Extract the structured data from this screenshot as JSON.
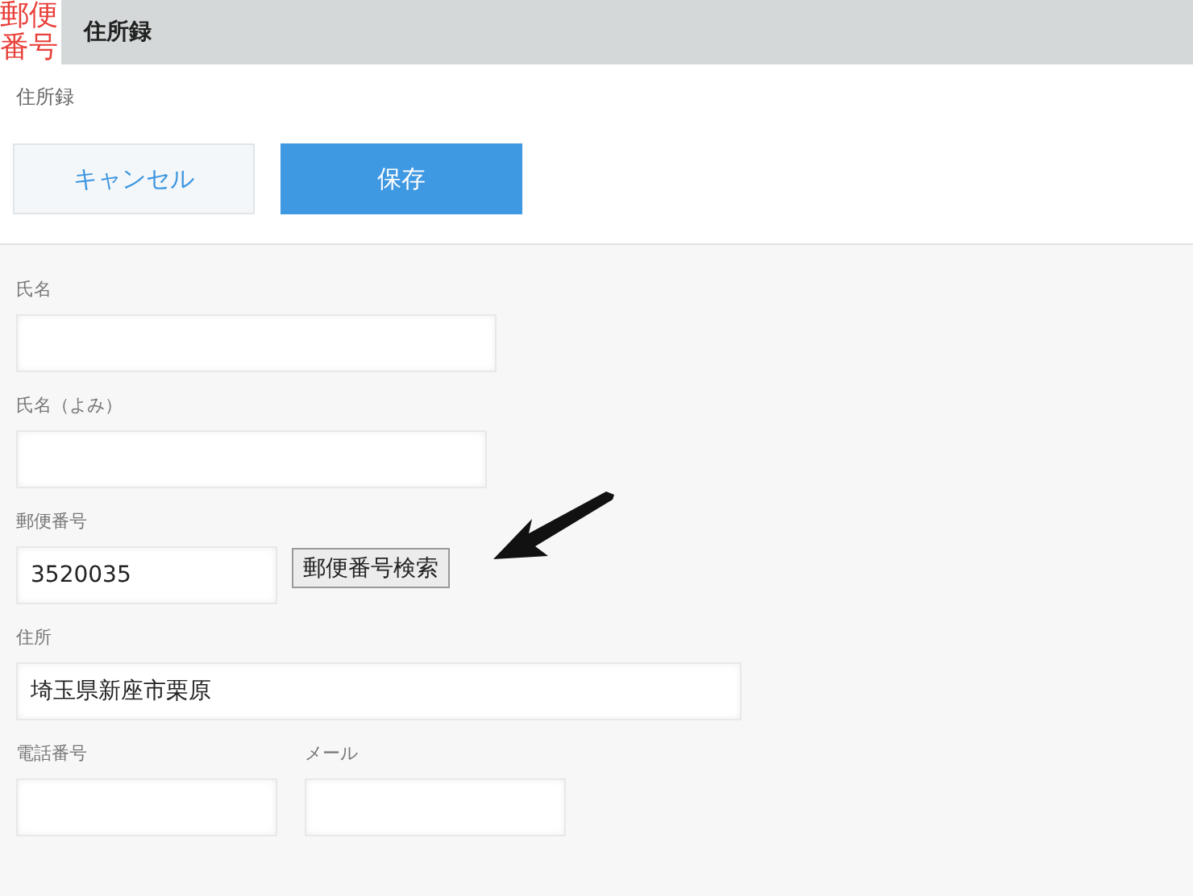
{
  "logo": "郵便番号",
  "header": {
    "title": "住所録"
  },
  "breadcrumb": "住所録",
  "buttons": [
    {
      "label": "キャンセル",
      "kind": "secondary"
    },
    {
      "label": "保存",
      "kind": "primary"
    }
  ],
  "rows": [
    {
      "fields": [
        {
          "label": "氏名"
        }
      ]
    },
    {
      "fields": [
        {
          "label": "氏名（よみ）"
        }
      ]
    },
    {
      "fields": [
        {
          "label": "郵便番号",
          "value": "3520035",
          "action": "郵便番号検索"
        }
      ]
    },
    {
      "fields": [
        {
          "label": "住所",
          "value": "埼玉県新座市栗原"
        }
      ]
    },
    {
      "fields": [
        {
          "label": "電話番号"
        },
        {
          "label": "メール"
        }
      ]
    }
  ]
}
